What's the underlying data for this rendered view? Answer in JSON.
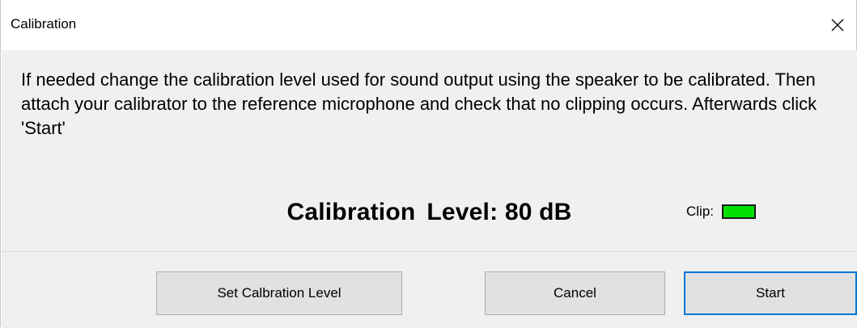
{
  "window": {
    "title": "Calibration"
  },
  "dialog": {
    "instructions": "If needed change the calibration level used for sound output using the speaker to be calibrated. Then attach your calibrator to the reference microphone and check that no clipping occurs. Afterwards click 'Start'",
    "level_label": "Calibration",
    "level_value": "Level: 80 dB",
    "clip_label": "Clip:",
    "clip_indicator_color": "#00e000"
  },
  "buttons": {
    "set_calibration_level": "Set Calbration Level",
    "cancel": "Cancel",
    "start": "Start"
  },
  "icons": {
    "close": "close-icon"
  }
}
